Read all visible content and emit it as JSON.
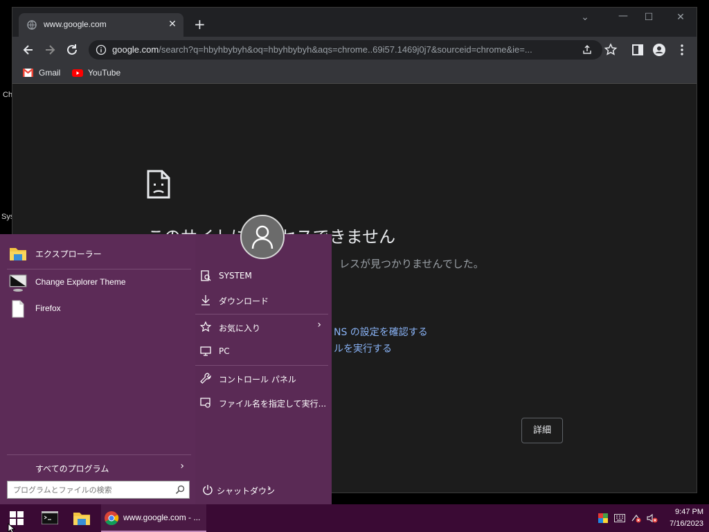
{
  "desktop": {
    "label_1": "Ch",
    "label_2": "Sys"
  },
  "browser": {
    "tab_title": "www.google.com",
    "new_tab": "+",
    "url_domain": "google.com",
    "url_rest": "/search?q=hbyhbybyh&oq=hbyhbybyh&aqs=chrome..69i57.1469j0j7&sourceid=chrome&ie=...",
    "bookmarks": [
      {
        "label": "Gmail"
      },
      {
        "label": "YouTube"
      }
    ]
  },
  "error_page": {
    "title": "このサイトにアクセスできません",
    "subtitle": "レスが見つかりませんでした。",
    "link_1": "NS の設定を確認する",
    "link_2": "ルを実行する",
    "details_button": "詳細"
  },
  "start_menu": {
    "pinned": [
      {
        "label": "エクスプローラー"
      },
      {
        "label": "Change Explorer Theme"
      },
      {
        "label": "Firefox"
      }
    ],
    "places": [
      {
        "label": "SYSTEM"
      },
      {
        "label": "ダウンロード"
      },
      {
        "label": "お気に入り"
      },
      {
        "label": "PC"
      },
      {
        "label": "コントロール パネル"
      },
      {
        "label": "ファイル名を指定して実行..."
      }
    ],
    "all_programs": "すべてのプログラム",
    "search_placeholder": "プログラムとファイルの検索",
    "shutdown": "シャットダウン"
  },
  "taskbar": {
    "chrome_label": "www.google.com - ...",
    "time": "9:47 PM",
    "date": "7/16/2023"
  },
  "colors": {
    "start_menu_bg": "#5c2b57",
    "taskbar_bg": "#3a0a34",
    "link": "#8ab4f8"
  }
}
